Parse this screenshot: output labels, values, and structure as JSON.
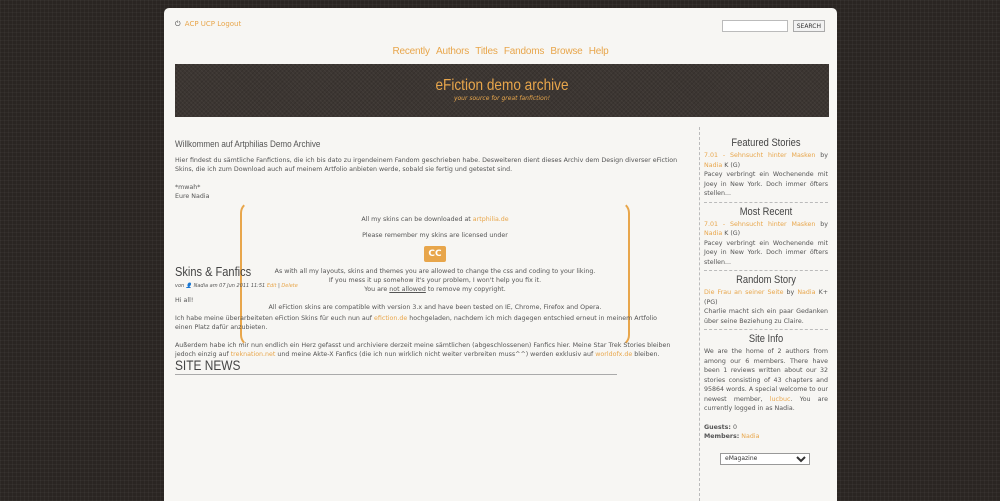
{
  "toplinks": {
    "power_icon": "power-icon",
    "acp": "ACP",
    "ucp": "UCP",
    "logout": "Logout"
  },
  "search": {
    "value": "",
    "button": "SEARCH"
  },
  "nav": [
    "Recently",
    "Authors",
    "Titles",
    "Fandoms",
    "Browse",
    "Help"
  ],
  "banner": {
    "title": "eFiction demo archive",
    "subtitle": "your source for great fanfiction!"
  },
  "welcome": {
    "title": "Willkommen auf Artphilias Demo Archive",
    "p1": "Hier findest du sämtliche Fanfictions, die ich bis dato zu irgendeinem Fandom geschrieben habe. Desweiteren dient dieses Archiv dem Design diverser eFiction Skins, die ich zum Download auch auf meinem Artfolio anbieten werde, sobald sie fertig und getestet sind.",
    "p2a": "*mwah*",
    "p2b": "Eure Nadia"
  },
  "infobox": {
    "l1": "All my skins can be downloaded at",
    "l1_link": "artphilia.de",
    "l2": "Please remember my skins are licensed under",
    "cc": "CC",
    "l3": "As with all my layouts, skins and themes you are allowed to change the css and coding to your liking.",
    "l4": "If you mess it up somehow it's your problem, I won't help you fix it.",
    "l5a": "You are",
    "l5u": "not allowed",
    "l5b": "to remove my copyright.",
    "l6": "All eFiction skins are compatible with version 3.x and have been tested on IE, Chrome, Firefox and Opera."
  },
  "site_news": "SITE NEWS",
  "news": {
    "title": "Skins & Fanfics",
    "meta_by": "von",
    "meta_author": "Nadia am 07 Jun 2011 11:51",
    "edit": "Edit",
    "delete": "Delete",
    "p1": "Hi all!",
    "p2a": "Ich habe meine überarbeiteten eFiction Skins für euch nun auf",
    "p2link": "efiction.de",
    "p2b": "hochgeladen, nachdem ich mich dagegen entschied erneut in meinem Artfolio einen Platz dafür anzubieten.",
    "p3a": "Außerdem habe ich mir nun endlich ein Herz gefasst und archiviere derzeit meine sämtlichen (abgeschlossenen) Fanfics hier. Meine Star Trek Stories bleiben jedoch einzig auf",
    "p3link1": "treknation.net",
    "p3b": "und meine Akte-X Fanfics (die ich nun wirklich nicht weiter verbreiten muss^^) werden exklusiv auf",
    "p3link2": "worldofx.de",
    "p3c": "bleiben."
  },
  "sidebar": {
    "featured": {
      "title": "Featured Stories",
      "story": "7.01 - Sehnsucht hinter Masken",
      "by": "by",
      "author": "Nadia",
      "rating": "K (G)",
      "summary": "Pacey verbringt ein Wochenende mit Joey in New York. Doch immer öfters stellen..."
    },
    "recent": {
      "title": "Most Recent",
      "story": "7.01 - Sehnsucht hinter Masken",
      "by": "by",
      "author": "Nadia",
      "rating": "K (G)",
      "summary": "Pacey verbringt ein Wochenende mit Joey in New York. Doch immer öfters stellen..."
    },
    "random": {
      "title": "Random Story",
      "story": "Die Frau an seiner Seite",
      "by": "by",
      "author": "Nadia",
      "rating": "K+ (PG)",
      "summary": "Charlie macht sich ein paar Gedanken über seine Beziehung zu Claire."
    },
    "info": {
      "title": "Site Info",
      "text_a": "We are the home of 2 authors from among our 6 members. There have been 1 reviews written about our 32 stories consisting of 43 chapters and 95864 words. A special welcome to our newest member,",
      "newest": "lucbuc",
      "text_b": ". You are currently logged in as Nadia.",
      "guests_label": "Guests:",
      "guests": "0",
      "members_label": "Members:",
      "members": "Nadia"
    },
    "select": "eMagazine"
  }
}
